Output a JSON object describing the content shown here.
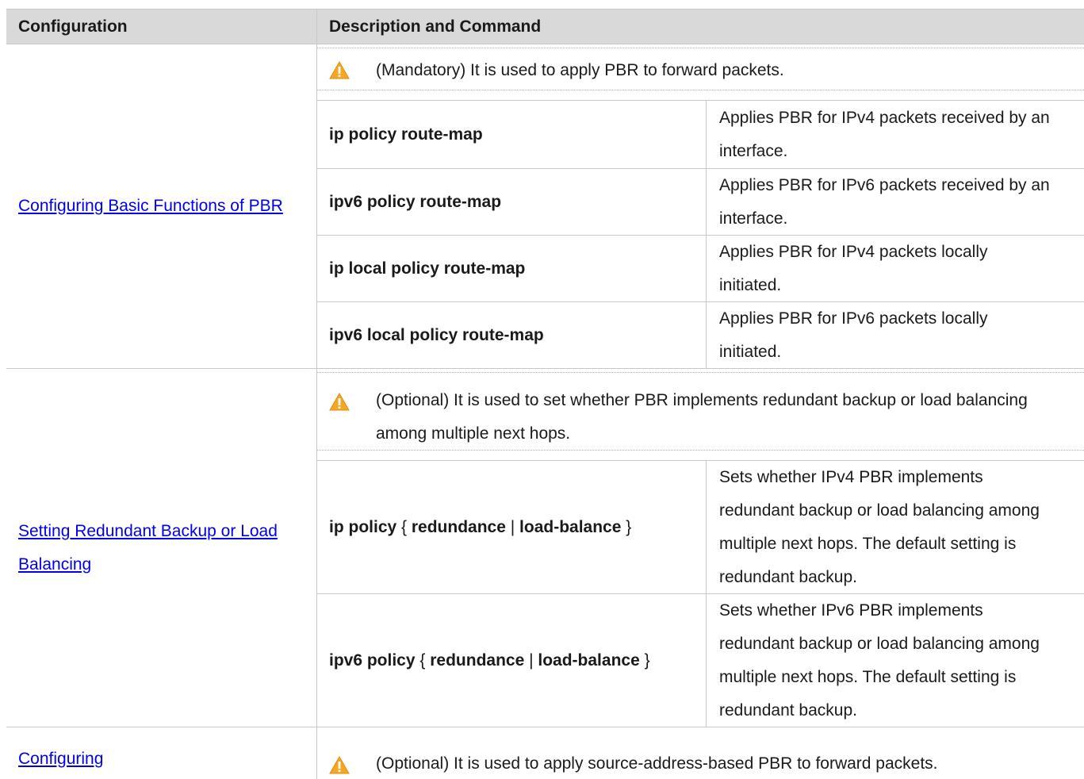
{
  "table": {
    "headers": {
      "configuration": "Configuration",
      "description_and_command": "Description and Command"
    },
    "sections": [
      {
        "link": "Configuring Basic Functions of PBR",
        "note": "(Mandatory) It is used to apply PBR to forward packets.",
        "commands": [
          {
            "bold1": "ip policy route-map",
            "description": "Applies PBR for IPv4 packets received by an interface."
          },
          {
            "bold1": "ipv6 policy route-map",
            "description": "Applies PBR for IPv6 packets received by an interface."
          },
          {
            "bold1": "ip local policy route-map",
            "description": "Applies PBR for IPv4 packets locally initiated."
          },
          {
            "bold1": "ipv6 local policy route-map",
            "description": "Applies PBR for IPv6 packets locally initiated."
          }
        ]
      },
      {
        "link": "Setting Redundant Backup or Load Balancing",
        "note": "(Optional) It is used to set whether PBR implements redundant backup or load balancing among multiple next hops.",
        "commands": [
          {
            "bold1": "ip policy",
            "sym1": " { ",
            "bold2": "redundance",
            "sym2": " | ",
            "bold3": "load-balance",
            "sym3": " }",
            "description": "Sets whether IPv4 PBR implements redundant backup or load balancing among multiple next hops. The default setting is redundant backup."
          },
          {
            "bold1": "ipv6 policy",
            "sym1": " { ",
            "bold2": "redundance",
            "sym2": " | ",
            "bold3": "load-balance",
            "sym3": " }",
            "description": "Sets whether IPv6 PBR implements redundant backup or load balancing among multiple next hops. The default setting is redundant backup."
          }
        ]
      },
      {
        "link": "Configuring",
        "note": "(Optional) It is used to apply source-address-based PBR to forward packets.",
        "commands": []
      }
    ]
  },
  "icons": {
    "warning": "warning-triangle-icon",
    "warning_fill": "#f5a623",
    "warning_mark": "#ffffff"
  },
  "colors": {
    "header_bg": "#d9d9d9",
    "link": "#0000ee",
    "border": "#c8c8c8"
  }
}
